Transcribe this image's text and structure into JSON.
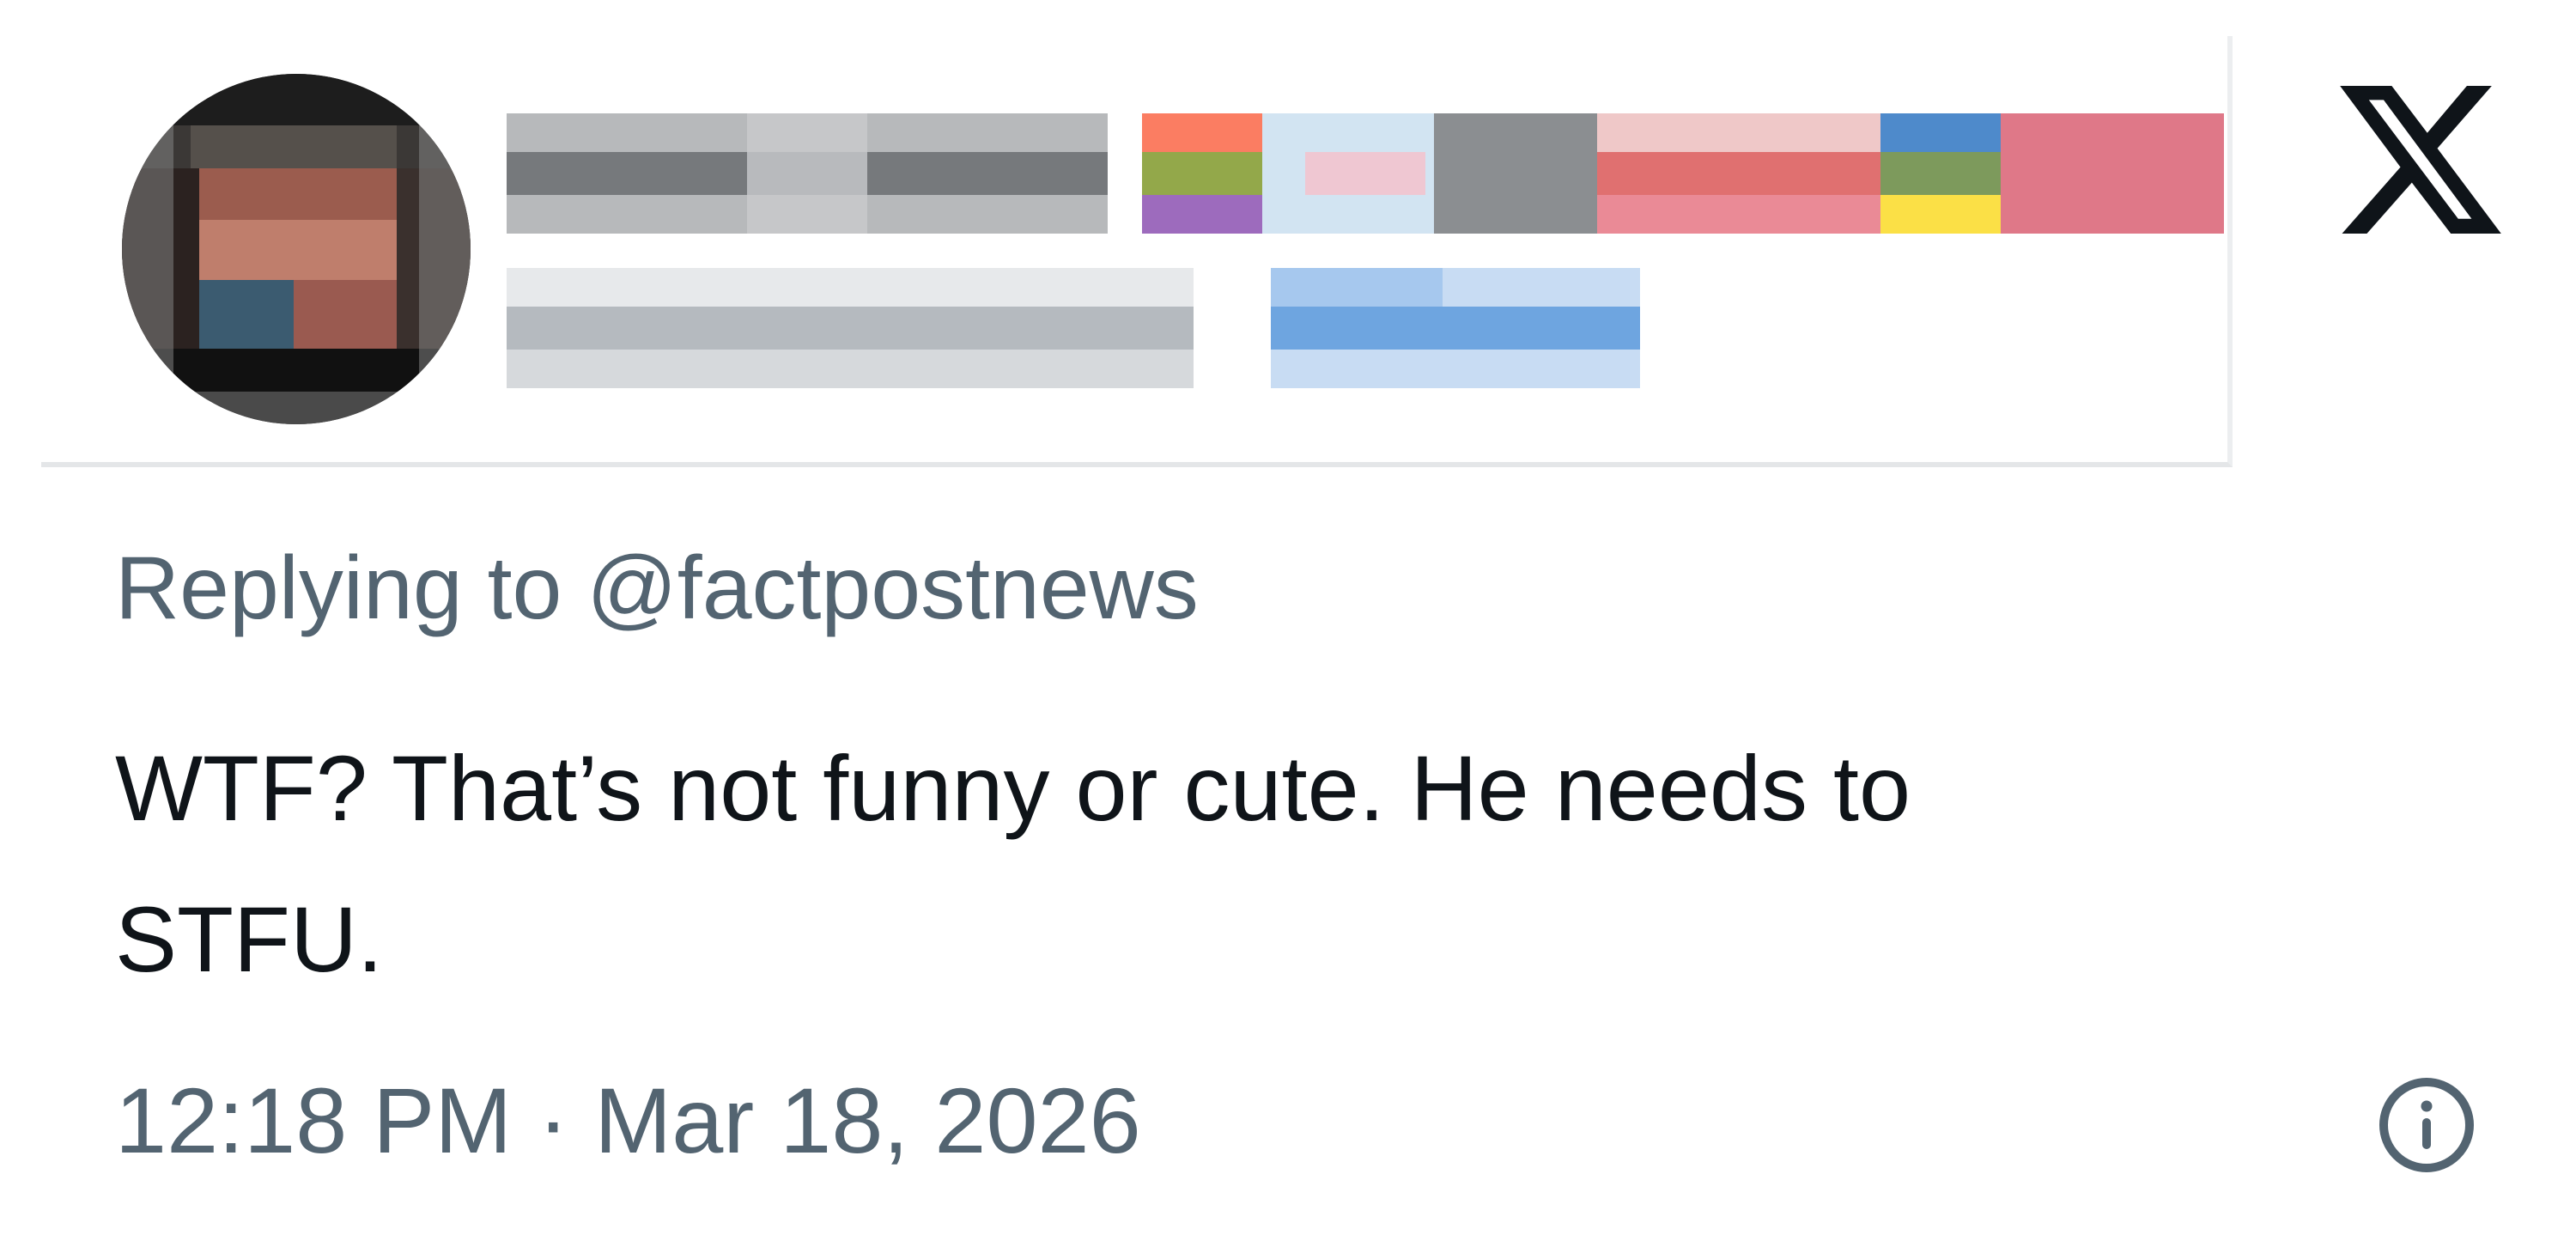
{
  "post": {
    "replying_prefix": "Replying to",
    "replying_handle": "@factpostnews",
    "body_line1": "WTF? That’s not funny or cute. He needs to",
    "body_line2": "STFU.",
    "time": "12:18 PM",
    "separator": "·",
    "date": "Mar 18, 2026"
  },
  "icons": {
    "logo": "x-logo-icon",
    "info": "info-icon",
    "avatar": "avatar-pixelated"
  },
  "colors": {
    "primary_text": "#0f1419",
    "secondary_text": "#536471",
    "border": "#e4e6e8"
  }
}
